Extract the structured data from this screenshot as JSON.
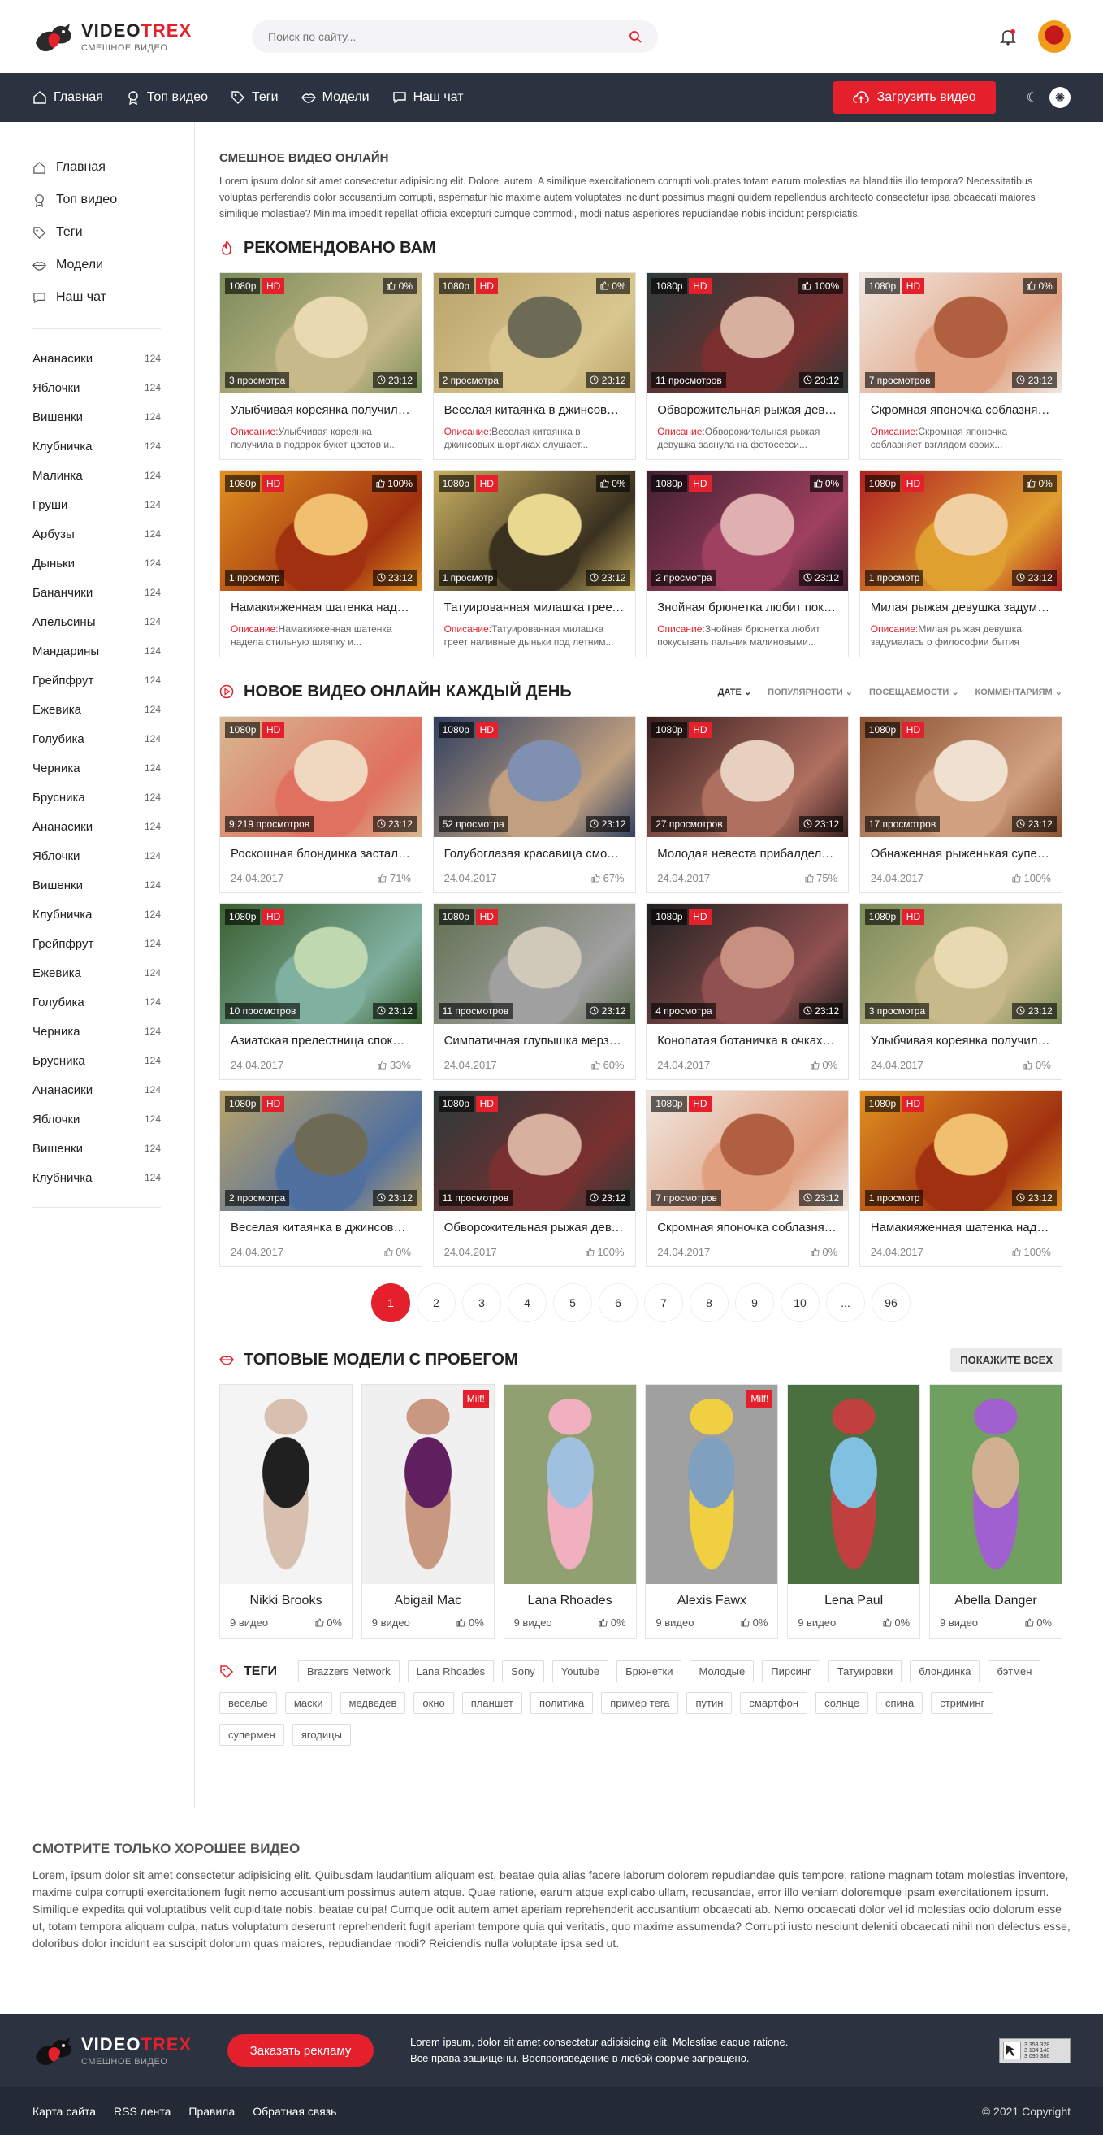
{
  "header": {
    "logo_title_1": "VIDEO",
    "logo_title_2": "TREX",
    "logo_sub": "СМЕШНОЕ ВИДЕО",
    "search_placeholder": "Поиск по сайту..."
  },
  "nav": {
    "items": [
      "Главная",
      "Топ видео",
      "Теги",
      "Модели",
      "Наш чат"
    ],
    "upload": "Загрузить видео"
  },
  "sidebar": {
    "menu": [
      "Главная",
      "Топ видео",
      "Теги",
      "Модели",
      "Наш чат"
    ],
    "categories": [
      {
        "name": "Ананасики",
        "count": "124"
      },
      {
        "name": "Яблочки",
        "count": "124"
      },
      {
        "name": "Вишенки",
        "count": "124"
      },
      {
        "name": "Клубничка",
        "count": "124"
      },
      {
        "name": "Малинка",
        "count": "124"
      },
      {
        "name": "Груши",
        "count": "124"
      },
      {
        "name": "Арбузы",
        "count": "124"
      },
      {
        "name": "Дыньки",
        "count": "124"
      },
      {
        "name": "Бананчики",
        "count": "124"
      },
      {
        "name": "Апельсины",
        "count": "124"
      },
      {
        "name": "Мандарины",
        "count": "124"
      },
      {
        "name": "Грейпфрут",
        "count": "124"
      },
      {
        "name": "Ежевика",
        "count": "124"
      },
      {
        "name": "Голубика",
        "count": "124"
      },
      {
        "name": "Черника",
        "count": "124"
      },
      {
        "name": "Брусника",
        "count": "124"
      },
      {
        "name": "Ананасики",
        "count": "124"
      },
      {
        "name": "Яблочки",
        "count": "124"
      },
      {
        "name": "Вишенки",
        "count": "124"
      },
      {
        "name": "Клубничка",
        "count": "124"
      },
      {
        "name": "Грейпфрут",
        "count": "124"
      },
      {
        "name": "Ежевика",
        "count": "124"
      },
      {
        "name": "Голубика",
        "count": "124"
      },
      {
        "name": "Черника",
        "count": "124"
      },
      {
        "name": "Брусника",
        "count": "124"
      },
      {
        "name": "Ананасики",
        "count": "124"
      },
      {
        "name": "Яблочки",
        "count": "124"
      },
      {
        "name": "Вишенки",
        "count": "124"
      },
      {
        "name": "Клубничка",
        "count": "124"
      }
    ]
  },
  "intro": {
    "title": "СМЕШНОЕ ВИДЕО ОНЛАЙН",
    "text": "Lorem ipsum dolor sit amet consectetur adipisicing elit. Dolore, autem. A similique exercitationem corrupti voluptates totam earum molestias ea blanditiis illo tempora? Necessitatibus voluptas perferendis dolor accusantium corrupti, aspernatur hic maxime autem voluptates incidunt possimus magni quidem repellendus architecto consectetur ipsa obcaecati maiores similique molestiae? Minima impedit repellat officia excepturi cumque commodi, modi natus asperiores repudiandae nobis incidunt perspiciatis."
  },
  "recommended": {
    "title": "РЕКОМЕНДОВАНО ВАМ",
    "desc_label": "Описание:",
    "cards": [
      {
        "res": "1080p",
        "hd": "HD",
        "like": "0%",
        "views": "3 просмотра",
        "dur": "23:12",
        "title": "Улыбчивая кореянка получила в подарок букет цветов",
        "desc": "Улыбчивая кореянка получила в подарок букет цветов и...",
        "palette": [
          "#7a8c5a",
          "#c8b98a",
          "#e8d9b0"
        ]
      },
      {
        "res": "1080p",
        "hd": "HD",
        "like": "0%",
        "views": "2 просмотра",
        "dur": "23:12",
        "title": "Веселая китаянка в джинсовых шортиках",
        "desc": "Веселая китаянка в джинсовых шортиках слушает...",
        "palette": [
          "#b9a36a",
          "#d9c78f",
          "#6d6b55"
        ]
      },
      {
        "res": "1080p",
        "hd": "HD",
        "like": "100%",
        "views": "11 просмотров",
        "dur": "23:12",
        "title": "Обворожительная рыжая девушка заснула",
        "desc": "Обворожительная рыжая девушка заснула на фотосесси...",
        "palette": [
          "#2c3a3a",
          "#7a3030",
          "#d8b0a0"
        ]
      },
      {
        "res": "1080p",
        "hd": "HD",
        "like": "0%",
        "views": "7 просмотров",
        "dur": "23:12",
        "title": "Скромная японочка соблазняет взглядом",
        "desc": "Скромная японочка соблазняет взглядом своих...",
        "palette": [
          "#f0e8e0",
          "#e0a080",
          "#b06040"
        ]
      },
      {
        "res": "1080p",
        "hd": "HD",
        "like": "100%",
        "views": "1 просмотр",
        "dur": "23:12",
        "title": "Намакияженная шатенка надела стильную шляпку",
        "desc": "Намакияженная шатенка надела стильную шляпку и...",
        "palette": [
          "#e09020",
          "#a03010",
          "#f0c070"
        ]
      },
      {
        "res": "1080p",
        "hd": "HD",
        "like": "0%",
        "views": "1 просмотр",
        "dur": "23:12",
        "title": "Татуированная милашка греет наливные дыньки",
        "desc": "Татуированная милашка греет наливные дыньки под летним...",
        "palette": [
          "#c8b060",
          "#3a3020",
          "#e8d890"
        ]
      },
      {
        "res": "1080p",
        "hd": "HD",
        "like": "0%",
        "views": "2 просмотра",
        "dur": "23:12",
        "title": "Знойная брюнетка любит покусывать пальчик",
        "desc": "Знойная брюнетка любит покусывать пальчик малиновыми...",
        "palette": [
          "#402030",
          "#a04060",
          "#e0b0b0"
        ]
      },
      {
        "res": "1080p",
        "hd": "HD",
        "like": "0%",
        "views": "1 просмотр",
        "dur": "23:12",
        "title": "Милая рыжая девушка задумалась о философии",
        "desc": "Милая рыжая девушка задумалась о философии бытия",
        "palette": [
          "#b02020",
          "#e0a030",
          "#f0d0a0"
        ]
      }
    ]
  },
  "newvideos": {
    "title": "НОВОЕ ВИДЕО ОНЛАЙН КАЖДЫЙ ДЕНЬ",
    "sorts": [
      "ДАТЕ",
      "ПОПУЛЯРНОСТИ",
      "ПОСЕЩАЕМОСТИ",
      "КОММЕНТАРИЯМ"
    ],
    "cards": [
      {
        "res": "1080p",
        "hd": "HD",
        "views": "9 219 просмотров",
        "dur": "23:12",
        "title": "Роскошная блондинка застала врасплох",
        "date": "24.04.2017",
        "rating": "71%",
        "palette": [
          "#d8b890",
          "#e07060",
          "#f0d8c0"
        ]
      },
      {
        "res": "1080p",
        "hd": "HD",
        "views": "52 просмотра",
        "dur": "23:12",
        "title": "Голубоглазая красавица смотрит в камеру",
        "date": "24.04.2017",
        "rating": "67%",
        "palette": [
          "#304060",
          "#c0a080",
          "#8090b0"
        ]
      },
      {
        "res": "1080p",
        "hd": "HD",
        "views": "27 просмотров",
        "dur": "23:12",
        "title": "Молодая невеста прибалдела от счастья",
        "date": "24.04.2017",
        "rating": "75%",
        "palette": [
          "#3a2020",
          "#b07060",
          "#e8d0c0"
        ]
      },
      {
        "res": "1080p",
        "hd": "HD",
        "views": "17 просмотров",
        "dur": "23:12",
        "title": "Обнаженная рыженькая супермодель",
        "date": "24.04.2017",
        "rating": "100%",
        "palette": [
          "#8a5030",
          "#d0a080",
          "#f0e0d0"
        ]
      },
      {
        "res": "1080p",
        "hd": "HD",
        "views": "10 просмотров",
        "dur": "23:12",
        "title": "Азиатская прелестница спокойно гуляет",
        "date": "24.04.2017",
        "rating": "33%",
        "palette": [
          "#3a6030",
          "#80b0a0",
          "#c0d8b0"
        ]
      },
      {
        "res": "1080p",
        "hd": "HD",
        "views": "11 просмотров",
        "dur": "23:12",
        "title": "Симпатичная глупышка мерзнет на дороге",
        "date": "24.04.2017",
        "rating": "60%",
        "palette": [
          "#607050",
          "#a0a0a0",
          "#d0c8b8"
        ]
      },
      {
        "res": "1080p",
        "hd": "HD",
        "views": "4 просмотра",
        "dur": "23:12",
        "title": "Конопатая ботаничка в очках позирует",
        "date": "24.04.2017",
        "rating": "0%",
        "palette": [
          "#202020",
          "#905050",
          "#c89080"
        ]
      },
      {
        "res": "1080p",
        "hd": "HD",
        "views": "3 просмотра",
        "dur": "23:12",
        "title": "Улыбчивая кореянка получила в подарок",
        "date": "24.04.2017",
        "rating": "0%",
        "palette": [
          "#7a8c5a",
          "#c8b98a",
          "#e8d9b0"
        ]
      },
      {
        "res": "1080p",
        "hd": "HD",
        "views": "2 просмотра",
        "dur": "23:12",
        "title": "Веселая китаянка в джинсовых шортиках",
        "date": "24.04.2017",
        "rating": "0%",
        "palette": [
          "#b9a36a",
          "#5070a0",
          "#6d6b55"
        ]
      },
      {
        "res": "1080p",
        "hd": "HD",
        "views": "11 просмотров",
        "dur": "23:12",
        "title": "Обворожительная рыжая девушка заснула",
        "date": "24.04.2017",
        "rating": "100%",
        "palette": [
          "#2c3a3a",
          "#7a3030",
          "#d8b0a0"
        ]
      },
      {
        "res": "1080p",
        "hd": "HD",
        "views": "7 просмотров",
        "dur": "23:12",
        "title": "Скромная японочка соблазняет взглядом",
        "date": "24.04.2017",
        "rating": "0%",
        "palette": [
          "#f0e8e0",
          "#e0a080",
          "#b06040"
        ]
      },
      {
        "res": "1080p",
        "hd": "HD",
        "views": "1 просмотр",
        "dur": "23:12",
        "title": "Намакияженная шатенка надела шляпку",
        "date": "24.04.2017",
        "rating": "100%",
        "palette": [
          "#e09020",
          "#a03010",
          "#f0c070"
        ]
      }
    ]
  },
  "pagination": [
    "1",
    "2",
    "3",
    "4",
    "5",
    "6",
    "7",
    "8",
    "9",
    "10",
    "...",
    "96"
  ],
  "models": {
    "title": "ТОПОВЫЕ МОДЕЛИ С ПРОБЕГОМ",
    "show_all": "Покажите всех",
    "items": [
      {
        "name": "Nikki Brooks",
        "videos": "9 видео",
        "rating": "0%",
        "milf": "",
        "palette": [
          "#f4f4f4",
          "#d8c0b0",
          "#202020"
        ]
      },
      {
        "name": "Abigail Mac",
        "videos": "9 видео",
        "rating": "0%",
        "milf": "Milf!",
        "palette": [
          "#f0f0f0",
          "#c89880",
          "#602060"
        ]
      },
      {
        "name": "Lana Rhoades",
        "videos": "9 видео",
        "rating": "0%",
        "milf": "",
        "palette": [
          "#90a070",
          "#f0b0c0",
          "#a0c0e0"
        ]
      },
      {
        "name": "Alexis Fawx",
        "videos": "9 видео",
        "rating": "0%",
        "milf": "Milf!",
        "palette": [
          "#a0a0a0",
          "#f0d040",
          "#80a0c0"
        ]
      },
      {
        "name": "Lena Paul",
        "videos": "9 видео",
        "rating": "0%",
        "milf": "",
        "palette": [
          "#4a7040",
          "#c04040",
          "#80c0e0"
        ]
      },
      {
        "name": "Abella Danger",
        "videos": "9 видео",
        "rating": "0%",
        "milf": "",
        "palette": [
          "#70a060",
          "#a060d0",
          "#d0b090"
        ]
      }
    ]
  },
  "tags": {
    "title": "ТЕГИ",
    "items": [
      "Brazzers Network",
      "Lana Rhoades",
      "Sony",
      "Youtube",
      "Брюнетки",
      "Молодые",
      "Пирсинг",
      "Татуировки",
      "блондинка",
      "бэтмен",
      "веселье",
      "маски",
      "медведев",
      "окно",
      "планшет",
      "политика",
      "пример тега",
      "путин",
      "смартфон",
      "солнце",
      "спина",
      "стриминг",
      "супермен",
      "ягодицы"
    ]
  },
  "seo": {
    "title": "СМОТРИТЕ ТОЛЬКО ХОРОШЕЕ ВИДЕО",
    "text": "Lorem, ipsum dolor sit amet consectetur adipisicing elit. Quibusdam laudantium aliquam est, beatae quia alias facere laborum dolorem repudiandae quis tempore, ratione magnam totam molestias inventore, maxime culpa corrupti exercitationem fugit nemo accusantium possimus autem atque. Quae ratione, earum atque explicabo ullam, recusandae, error illo veniam doloremque ipsam exercitationem ipsum. Similique expedita qui voluptatibus velit cupiditate nobis. beatae culpa! Cumque odit autem amet aperiam reprehenderit accusantium obcaecati ab. Nemo obcaecati dolor vel id molestias odio dolorum esse ut, totam tempora aliquam culpa, natus voluptatum deserunt reprehenderit fugit aperiam tempore quia qui veritatis, quo maxime assumenda? Corrupti iusto nesciunt deleniti obcaecati nihil non delectus esse, doloribus dolor incidunt ea suscipit dolorum quas maiores, repudiandae modi? Reiciendis nulla voluptate ipsa sed ut."
  },
  "footer": {
    "ad_button": "Заказать рекламу",
    "text_line1": "Lorem ipsum, dolor sit amet consectetur adipisicing elit. Molestiae eaque ratione.",
    "text_line2": "Все права защищены. Воспроизведение в любой форме запрещено.",
    "counter": [
      "3 353 328",
      "3 134 140",
      "3 090 386"
    ],
    "links": [
      "Карта сайта",
      "RSS лента",
      "Правила",
      "Обратная связь"
    ],
    "copyright": "© 2021 Copyright"
  },
  "colors": {
    "accent": "#e3202c",
    "dark": "#2b3340",
    "darker": "#232a35"
  }
}
